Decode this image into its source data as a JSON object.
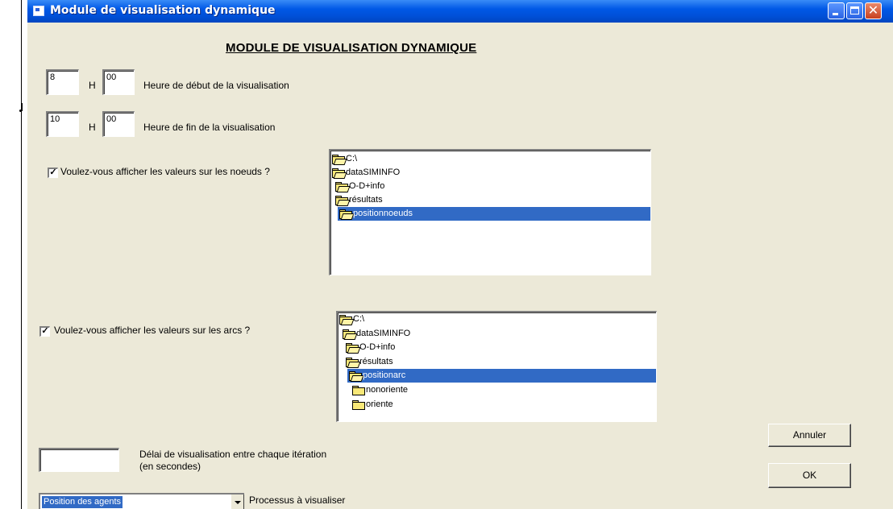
{
  "window": {
    "title": "Module de visualisation dynamique"
  },
  "heading": "MODULE DE VISUALISATION DYNAMIQUE",
  "start_time": {
    "hour": "8",
    "minute": "00",
    "separator": "H",
    "label": "Heure de début de la visualisation"
  },
  "end_time": {
    "hour": "10",
    "minute": "00",
    "separator": "H",
    "label": "Heure de fin de la visualisation"
  },
  "nodes": {
    "checkbox_label": "Voulez-vous afficher les valeurs sur les noeuds ?",
    "checked": true,
    "tree": [
      {
        "label": "C:\\",
        "icon": "folder-open-icon",
        "selected": false
      },
      {
        "label": "dataSIMINFO",
        "icon": "folder-open-icon",
        "selected": false
      },
      {
        "label": "O-D+info",
        "icon": "folder-open-icon",
        "selected": false
      },
      {
        "label": "résultats",
        "icon": "folder-open-icon",
        "selected": false
      },
      {
        "label": "positionnoeuds",
        "icon": "folder-open-icon",
        "selected": true
      }
    ]
  },
  "arcs": {
    "checkbox_label": "Voulez-vous afficher les valeurs sur les arcs ?",
    "checked": true,
    "tree": [
      {
        "label": "C:\\",
        "icon": "folder-open-icon",
        "selected": false
      },
      {
        "label": "dataSIMINFO",
        "icon": "folder-open-icon",
        "selected": false
      },
      {
        "label": "O-D+info",
        "icon": "folder-open-icon",
        "selected": false
      },
      {
        "label": "résultats",
        "icon": "folder-open-icon",
        "selected": false
      },
      {
        "label": "positionarc",
        "icon": "folder-open-icon",
        "selected": true
      },
      {
        "label": "nonoriente",
        "icon": "folder-icon",
        "selected": false
      },
      {
        "label": "oriente",
        "icon": "folder-icon",
        "selected": false
      }
    ]
  },
  "delay": {
    "value": "",
    "label_line1": "Délai de visualisation entre chaque itération",
    "label_line2": "(en secondes)"
  },
  "buttons": {
    "cancel": "Annuler",
    "ok": "OK"
  },
  "process": {
    "selected": "Position des agents",
    "label": "Processus à visualiser"
  },
  "colors": {
    "titlebar": "#0058e6",
    "selection": "#316ac5",
    "window_bg": "#ece9d8"
  }
}
